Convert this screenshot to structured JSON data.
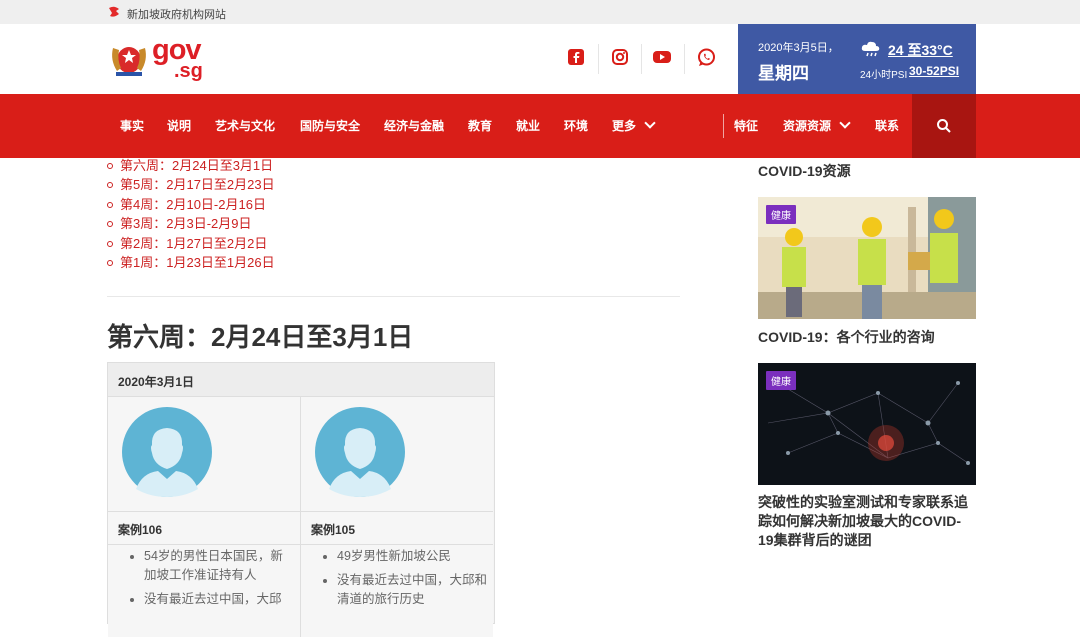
{
  "topbar": {
    "text": "新加坡政府机构网站"
  },
  "header": {
    "logo_gov": "gov",
    "logo_sg": ".sg",
    "social": [
      "facebook-icon",
      "instagram-icon",
      "youtube-icon",
      "whatsapp-icon"
    ]
  },
  "weather": {
    "date": "2020年3月5日，",
    "day": "星期四",
    "temp": "24 至33°C",
    "psi_label": "24小时PSI",
    "psi_value": "30-52PSI"
  },
  "nav": {
    "items": [
      "事实",
      "说明",
      "艺术与文化",
      "国防与安全",
      "经济与金融",
      "教育",
      "就业",
      "环境",
      "更多",
      "特征",
      "资源资源",
      "联系"
    ]
  },
  "main": {
    "weeks": [
      "第六周：2月24日至3月1日",
      "第5周：2月17日至2月23日",
      "第4周：2月10日-2月16日",
      "第3周：2月3日-2月9日",
      "第2周：1月27日至2月2日",
      "第1周：1月23日至1月26日"
    ],
    "heading": "第六周：2月24日至3月1日",
    "table": {
      "date": "2020年3月1日",
      "cases": [
        {
          "title": "案例106",
          "bullets": [
            "54岁的男性日本国民，新加坡工作准证持有人",
            "没有最近去过中国，大邱"
          ]
        },
        {
          "title": "案例105",
          "bullets": [
            "49岁男性新加坡公民",
            "没有最近去过中国，大邱和清道的旅行历史"
          ]
        }
      ]
    }
  },
  "sidebar": {
    "title1": "COVID-19资源",
    "card1_badge": "健康",
    "title2": "COVID-19：各个行业的咨询",
    "card2_badge": "健康",
    "title3": "突破性的实验室测试和专家联系追踪如何解决新加坡最大的COVID-19集群背后的谜团"
  },
  "colors": {
    "brand_red": "#d91e18",
    "weather_blue": "#3f59a4",
    "badge_purple": "#7b2fbe"
  }
}
